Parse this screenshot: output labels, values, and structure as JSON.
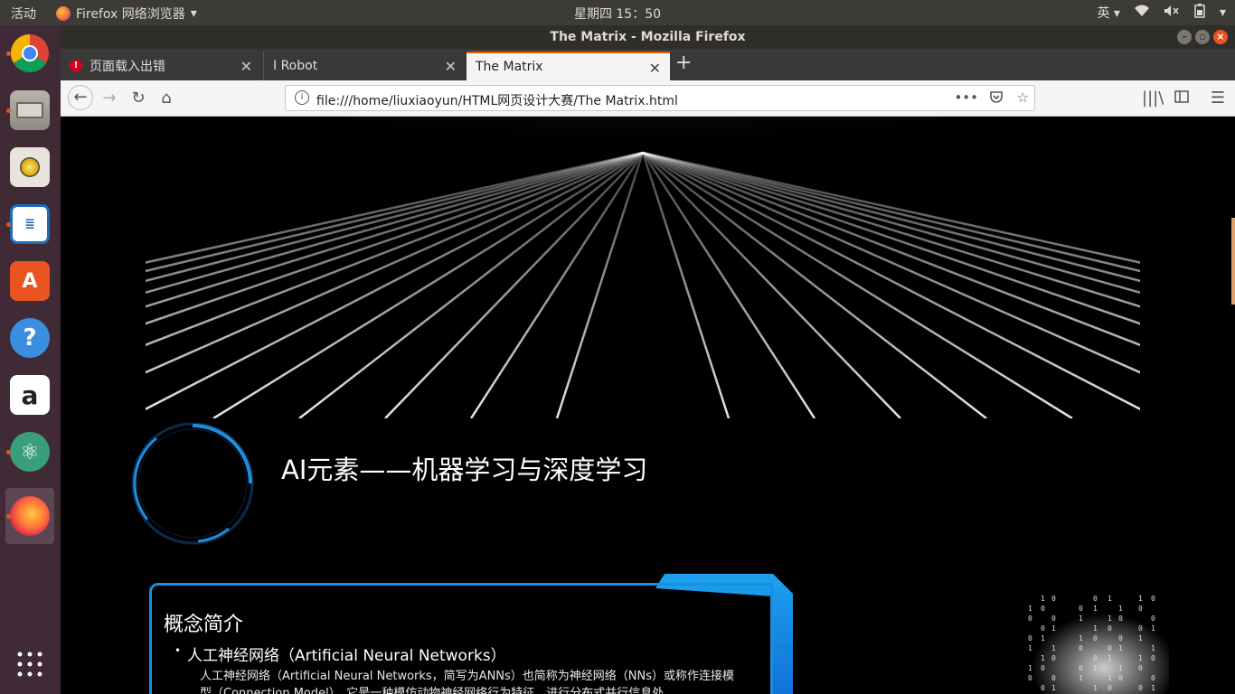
{
  "system": {
    "activities": "活动",
    "app_name": "Firefox 网络浏览器",
    "clock": "星期四 15：50",
    "input_method": "英"
  },
  "window": {
    "title": "The Matrix - Mozilla Firefox"
  },
  "tabs": [
    {
      "label": "页面载入出错",
      "state": "error"
    },
    {
      "label": "I Robot",
      "state": "normal"
    },
    {
      "label": "The Matrix",
      "state": "selected"
    }
  ],
  "navbar": {
    "url": "file:///home/liuxiaoyun/HTML网页设计大赛/The Matrix.html"
  },
  "launcher": {
    "items": [
      "chrome-icon",
      "files-icon",
      "rhythmbox-icon",
      "writer-icon",
      "software-center-icon",
      "help-icon",
      "amazon-icon",
      "atom-icon",
      "firefox-icon",
      "app-grid-icon"
    ]
  },
  "page": {
    "title": "AI元素——机器学习与深度学习",
    "card": {
      "heading": "概念简介",
      "item_title": "人工神经网络（Artificial Neural Networks）",
      "paragraph": "人工神经网络（Artificial Neural Networks，简写为ANNs）也简称为神经网络（NNs）或称作连接模型（Connection Model），它是一种模仿动物神经网络行为特征，进行分布式并行信息处"
    }
  },
  "colors": {
    "accent": "#1c8ee0",
    "ubuntu_orange": "#e95420",
    "launcher_bg": "#3f2a36"
  }
}
